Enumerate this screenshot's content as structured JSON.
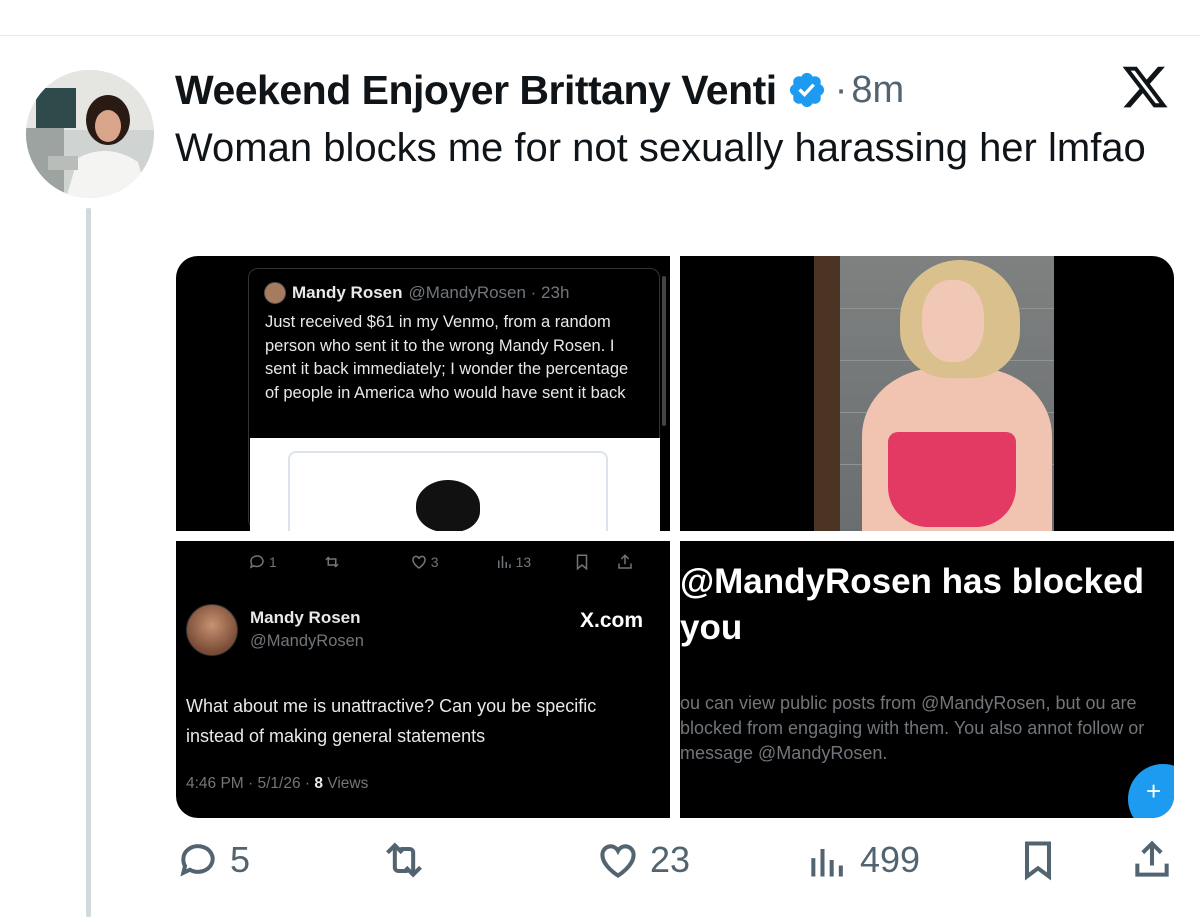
{
  "tweet": {
    "display_name": "Weekend Enjoyer Brittany Venti",
    "dot": "·",
    "time": "8m",
    "text": "Woman blocks me for not sexually harassing her lmfao"
  },
  "media": {
    "tile1": {
      "name": "Mandy Rosen",
      "handle_time": "@MandyRosen · 23h",
      "body": "Just received $61 in my Venmo, from a random person who sent it to the wrong Mandy Rosen. I sent it back immediately; I wonder the percentage of people in America who would have sent it back"
    },
    "tile3": {
      "stats": {
        "replies": "1",
        "likes": "3",
        "views": "13"
      },
      "name": "Mandy Rosen",
      "handle": "@MandyRosen",
      "xcom": "X.com",
      "body": "What about me is unattractive? Can you be specific instead of making general statements",
      "meta_prefix": "4:46 PM · 5/1/26 · ",
      "meta_views": "8",
      "meta_suffix": " Views"
    },
    "tile4": {
      "title": "@MandyRosen has blocked you",
      "body": "ou can view public posts from @MandyRosen, but ou are blocked from engaging with them. You also annot follow or message @MandyRosen.",
      "fab": "+"
    }
  },
  "actions": {
    "replies": "5",
    "likes": "23",
    "views": "499"
  },
  "colors": {
    "accent": "#1d9bf0",
    "text": "#0f1419",
    "muted": "#536471"
  }
}
